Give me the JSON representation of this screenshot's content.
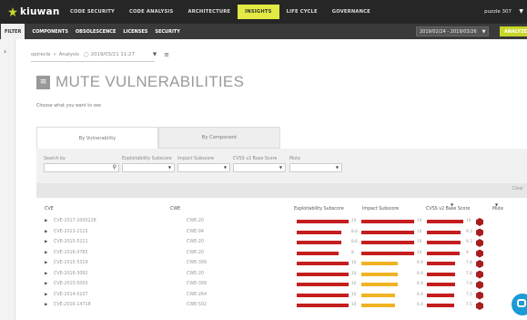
{
  "app": {
    "name": "kiuwan"
  },
  "topnav": {
    "items": [
      "CODE SECURITY",
      "CODE ANALYSIS",
      "ARCHITECTURE",
      "INSIGHTS",
      "LIFE CYCLE",
      "GOVERNANCE"
    ],
    "active": "INSIGHTS",
    "user": "puzzle 307"
  },
  "subnav": {
    "filter": "FILTER",
    "items": [
      "COMPONENTS",
      "OBSOLESCENCE",
      "LICENSES",
      "SECURITY"
    ],
    "date_range": "2019/02/24 - 2019/03/26",
    "analyze": "ANALYZE"
  },
  "breadcrumb": {
    "app": "opirecle",
    "section": "Analysis",
    "date": "2019/03/21 11:27"
  },
  "page": {
    "title": "MUTE VULNERABILITIES",
    "choose": "Choose what you want to see"
  },
  "tabs": [
    "By Vulnerability",
    "By Component"
  ],
  "filters": {
    "search_label": "Search by",
    "exploitability_label": "Exploitability Subscore",
    "impact_label": "Impact Subscore",
    "cvss_label": "CVSS v2 Base Score",
    "mute_label": "Mute",
    "clear": "Clear"
  },
  "table": {
    "headers": {
      "cve": "CVE",
      "cwe": "CWE",
      "exploitability": "Exploitability Subscore",
      "impact": "Impact Subscore",
      "cvss": "CVSS v2 Base Score",
      "mute": "Mute"
    },
    "rows": [
      {
        "cve": "CVE-2017-1000228",
        "cwe": "CWE-20",
        "exp": "10",
        "exp_v": 10,
        "imp": "10",
        "imp_v": 10,
        "cvss": "10",
        "cvss_v": 10
      },
      {
        "cve": "CVE-2013-2115",
        "cwe": "CWE-94",
        "exp": "8.6",
        "exp_v": 8.6,
        "imp": "10",
        "imp_v": 10,
        "cvss": "9.3",
        "cvss_v": 9.3
      },
      {
        "cve": "CVE-2015-5211",
        "cwe": "CWE-20",
        "exp": "8.6",
        "exp_v": 8.6,
        "imp": "10",
        "imp_v": 10,
        "cvss": "9.3",
        "cvss_v": 9.3
      },
      {
        "cve": "CVE-2016-0785",
        "cwe": "CWE-20",
        "exp": "8",
        "exp_v": 8,
        "imp": "10",
        "imp_v": 10,
        "cvss": "9",
        "cvss_v": 9
      },
      {
        "cve": "CVE-2015-5319",
        "cwe": "CWE-399",
        "exp": "10",
        "exp_v": 10,
        "imp": "6.9",
        "imp_v": 6.9,
        "cvss": "7.8",
        "cvss_v": 7.8
      },
      {
        "cve": "CVE-2016-3092",
        "cwe": "CWE-20",
        "exp": "10",
        "exp_v": 10,
        "imp": "6.9",
        "imp_v": 6.9,
        "cvss": "7.8",
        "cvss_v": 7.8
      },
      {
        "cve": "CVE-2015-5050",
        "cwe": "CWE-399",
        "exp": "10",
        "exp_v": 10,
        "imp": "6.9",
        "imp_v": 6.9,
        "cvss": "7.8",
        "cvss_v": 7.8
      },
      {
        "cve": "CVE-2014-0107",
        "cwe": "CWE-264",
        "exp": "10",
        "exp_v": 10,
        "imp": "6.4",
        "imp_v": 6.4,
        "cvss": "7.5",
        "cvss_v": 7.5
      },
      {
        "cve": "CVE-2016-14718",
        "cwe": "CWE-502",
        "exp": "10",
        "exp_v": 10,
        "imp": "6.4",
        "imp_v": 6.4,
        "cvss": "7.5",
        "cvss_v": 7.5
      }
    ]
  },
  "colors": {
    "high": "#c41e1e",
    "medium": "#f0b323",
    "accent": "#e2ea43",
    "analyze": "#c8d627",
    "hex": "#a81e1e"
  }
}
